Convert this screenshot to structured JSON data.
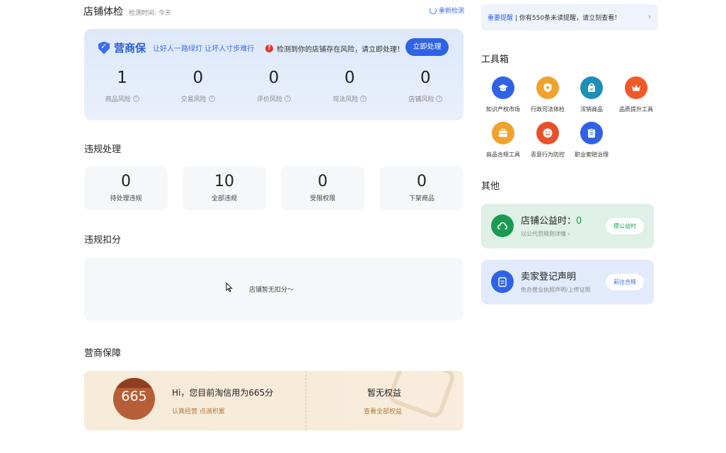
{
  "health": {
    "title": "店铺体检",
    "check_time": "检测时间: 今天",
    "refresh": "重新检测",
    "brand": "营商保",
    "slogan": "让好人一路绿灯 让坏人寸步难行",
    "risk_message": "检测到你的店铺存在风险，请立即处理！",
    "handle_button": "立即处理",
    "stats": [
      {
        "value": "1",
        "label": "商品风险"
      },
      {
        "value": "0",
        "label": "交易风险"
      },
      {
        "value": "0",
        "label": "评价风险"
      },
      {
        "value": "0",
        "label": "司法风险"
      },
      {
        "value": "0",
        "label": "店铺风险"
      }
    ]
  },
  "violation": {
    "title": "违规处理",
    "cards": [
      {
        "value": "0",
        "label": "待处理违规"
      },
      {
        "value": "10",
        "label": "全部违规"
      },
      {
        "value": "0",
        "label": "受限权限"
      },
      {
        "value": "0",
        "label": "下架商品"
      }
    ]
  },
  "deduction": {
    "title": "违规扣分",
    "empty_text": "店铺暂无扣分～"
  },
  "guarantee": {
    "title": "营商保障",
    "score": "665",
    "greeting": "Hi，您目前淘信用为665分",
    "subtext": "认真经营 点滴积累",
    "no_rights": "暂无权益",
    "view_all": "查看全部权益"
  },
  "notice": {
    "highlight": "重要提醒",
    "text": "| 你有550条未读提醒，请立刻查看！"
  },
  "toolbox": {
    "title": "工具箱",
    "items": [
      {
        "label": "知识产权市场",
        "icon": "graduation-cap-icon",
        "color": "#2f63e6"
      },
      {
        "label": "行政司法体检",
        "icon": "shield-icon",
        "color": "#f0a22e"
      },
      {
        "label": "浑销商品",
        "icon": "bag-icon",
        "color": "#1b8fb5"
      },
      {
        "label": "品质提升工具",
        "icon": "crown-icon",
        "color": "#f05a28"
      },
      {
        "label": "商品合规工具",
        "icon": "briefcase-icon",
        "color": "#f0a22e"
      },
      {
        "label": "恶意行为防控",
        "icon": "sad-face-icon",
        "color": "#e8502a"
      },
      {
        "label": "职业索赔治理",
        "icon": "document-icon",
        "color": "#2f63e6"
      }
    ]
  },
  "other": {
    "title": "其他",
    "welfare": {
      "title": "店铺公益时：",
      "value": "0",
      "sub": "以公代罚规则详情 ›",
      "button": "攒公益时",
      "color": "#1a9a52"
    },
    "declaration": {
      "title": "卖家登记声明",
      "sub": "免办营业执照声明/上传证照",
      "button": "前往合规",
      "color": "#2f63e6"
    }
  }
}
